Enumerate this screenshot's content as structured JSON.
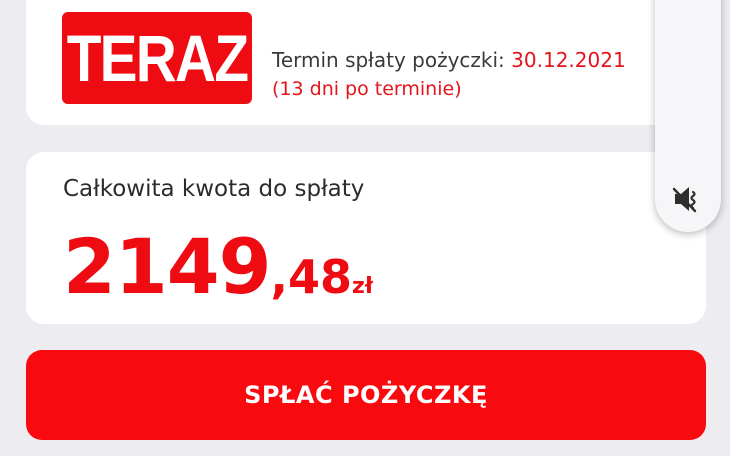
{
  "header": {
    "badge_text": "TERAZ",
    "due_label": "Termin spłaty pożyczki:",
    "due_date": "30.12.2021",
    "overdue_text": "(13 dni po terminie)"
  },
  "amount": {
    "label": "Całkowita kwota do spłaty",
    "integer_part": "2149",
    "fraction_part": ",48",
    "currency": "zł"
  },
  "action": {
    "pay_label": "SPŁAĆ POŻYCZKĘ"
  },
  "system": {
    "volume_icon": "volume-mute-icon"
  },
  "colors": {
    "accent_red": "#ee0b12",
    "button_red": "#f80a0e",
    "background": "#ececf1",
    "card": "#ffffff"
  }
}
